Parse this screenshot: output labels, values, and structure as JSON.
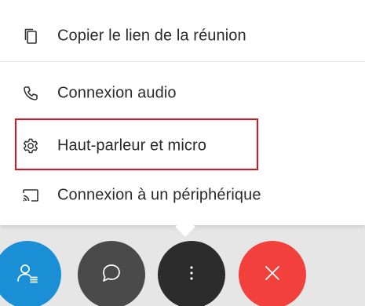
{
  "menu": {
    "items": [
      {
        "label": "Copier le lien de la réunion",
        "icon": "copy-icon"
      },
      {
        "label": "Connexion audio",
        "icon": "phone-icon"
      },
      {
        "label": "Haut-parleur et micro",
        "icon": "gear-icon",
        "highlighted": true
      },
      {
        "label": "Connexion à un périphérique",
        "icon": "cast-icon"
      }
    ]
  },
  "toolbar": {
    "buttons": [
      {
        "name": "participants",
        "icon": "participants-icon",
        "color": "#1b8fd6"
      },
      {
        "name": "chat",
        "icon": "chat-icon",
        "color": "#4a4a4a"
      },
      {
        "name": "more",
        "icon": "more-icon",
        "color": "#2c2c2c"
      },
      {
        "name": "leave",
        "icon": "close-icon",
        "color": "#f2413d"
      }
    ]
  },
  "colors": {
    "highlight_border": "#e0121d"
  }
}
